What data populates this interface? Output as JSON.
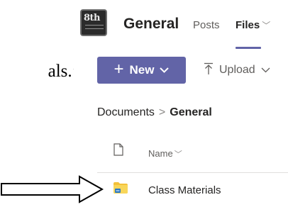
{
  "document": {
    "text_fragment": "als.’"
  },
  "channel": {
    "logo_text": "8th",
    "name": "General",
    "tabs": [
      {
        "label": "Posts"
      },
      {
        "label": "Files"
      }
    ]
  },
  "toolbar": {
    "new_label": "New",
    "upload_label": "Upload"
  },
  "breadcrumb": {
    "root": "Documents",
    "separator": ">",
    "current": "General"
  },
  "list": {
    "name_column": "Name",
    "items": [
      {
        "name": "Class Materials",
        "type": "folder"
      }
    ]
  },
  "colors": {
    "accent": "#6264a7",
    "folder": "#f3c13a",
    "link_badge": "#2b78c2"
  },
  "icons": [
    "plus-icon",
    "chevron-down-icon",
    "upload-icon",
    "file-type-icon",
    "folder-icon",
    "arrow-icon"
  ]
}
